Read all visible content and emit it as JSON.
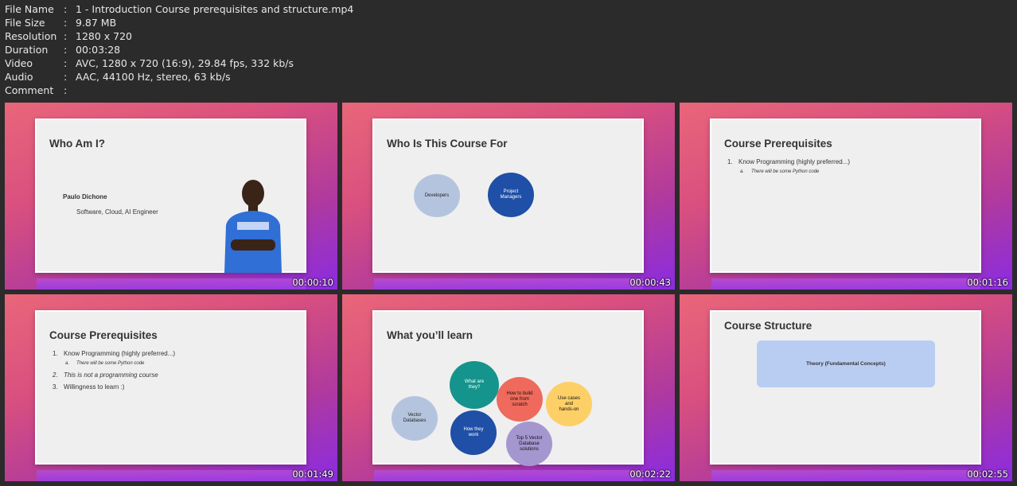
{
  "meta": [
    {
      "key": "File Name",
      "value": "1 - Introduction Course prerequisites and structure.mp4"
    },
    {
      "key": "File Size",
      "value": "9.87 MB"
    },
    {
      "key": "Resolution",
      "value": "1280 x 720"
    },
    {
      "key": "Duration",
      "value": "00:03:28"
    },
    {
      "key": "Video",
      "value": "AVC, 1280 x 720 (16:9), 29.84 fps, 332 kb/s"
    },
    {
      "key": "Audio",
      "value": "AAC, 44100 Hz, stereo, 63 kb/s"
    },
    {
      "key": "Comment",
      "value": ""
    }
  ],
  "sep": ":",
  "thumbs": [
    {
      "timestamp": "00:00:10",
      "title": "Who Am I?",
      "name": "Paulo Dichone",
      "role": "Software, Cloud, AI Engineer"
    },
    {
      "timestamp": "00:00:43",
      "title": "Who Is This Course For",
      "circles": [
        "Developers",
        "Project Managers"
      ]
    },
    {
      "timestamp": "00:01:16",
      "title": "Course Prerequisites",
      "items": [
        "1.",
        "Know Programming (highly preferred...)",
        "a.",
        "There will be some Python code"
      ]
    },
    {
      "timestamp": "00:01:49",
      "title": "Course Prerequisites",
      "items": [
        "1.",
        "Know Programming (highly preferred...)",
        "a.",
        "There will be some Python code",
        "2.",
        "This is not a programming course",
        "3.",
        "Willingness to learn :)"
      ]
    },
    {
      "timestamp": "00:02:22",
      "title": "What you’ll learn",
      "circles": [
        "Vector Databases",
        "What are they?",
        "How they work",
        "How to build one from scratch",
        "Top 5 Vector Database solutions",
        "Use cases and hands-on"
      ]
    },
    {
      "timestamp": "00:02:55",
      "title": "Course Structure",
      "box": "Theory (Fundamental Concepts)"
    }
  ]
}
